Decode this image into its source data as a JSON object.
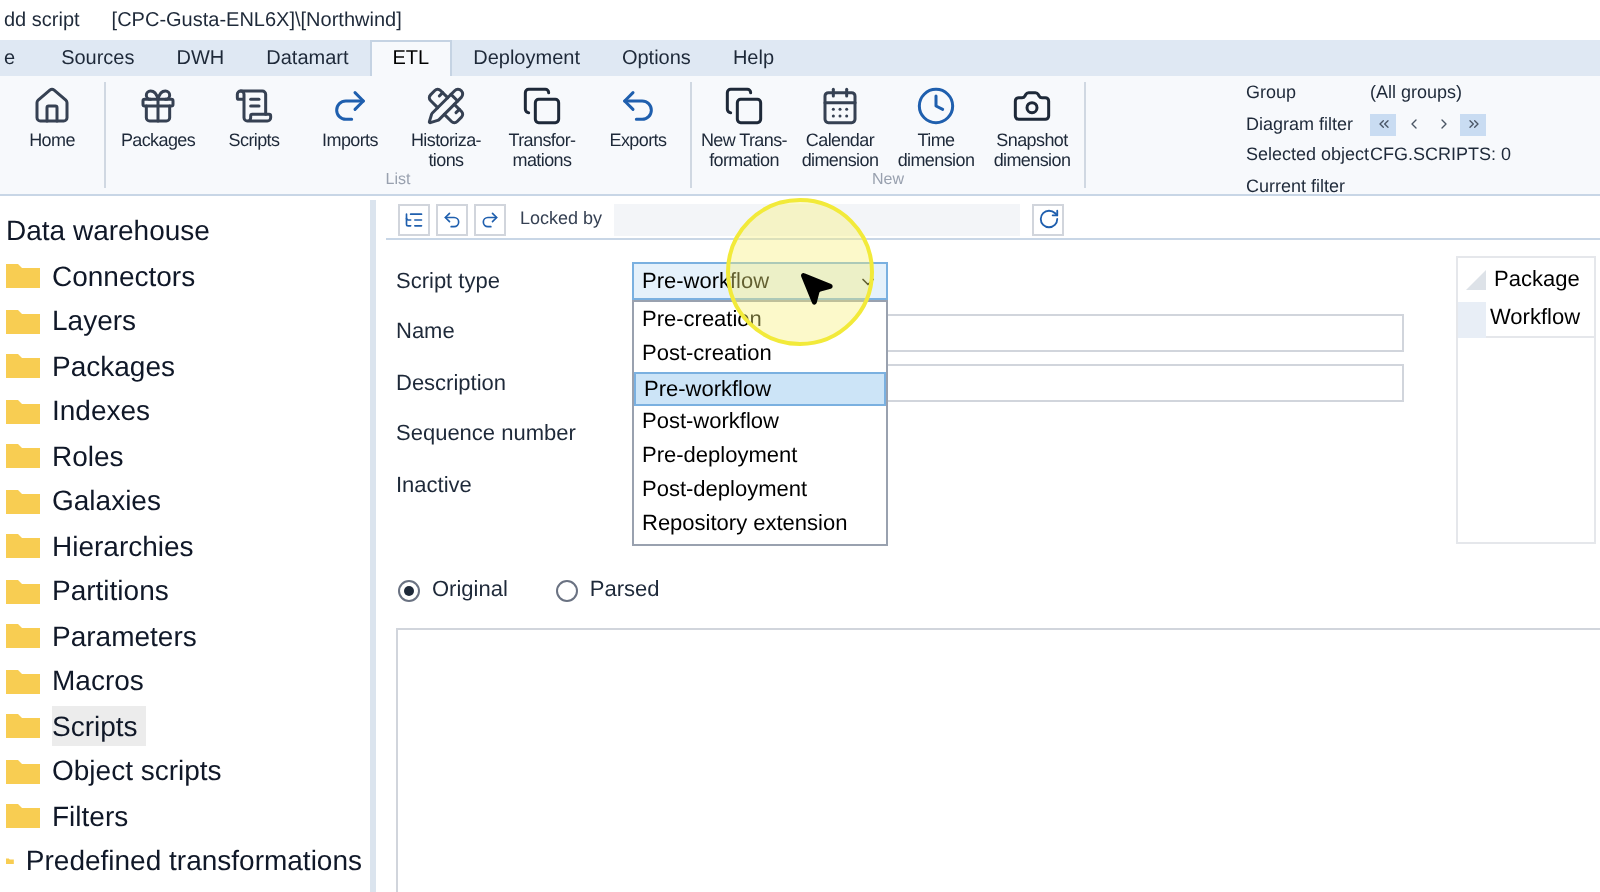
{
  "window": {
    "title": "dd script",
    "path": "[CPC-Gusta-ENL6X]\\[Northwind]"
  },
  "tabs": [
    {
      "label": "e",
      "selected": false
    },
    {
      "label": "Sources",
      "selected": false
    },
    {
      "label": "DWH",
      "selected": false
    },
    {
      "label": "Datamart",
      "selected": false
    },
    {
      "label": "ETL",
      "selected": true
    },
    {
      "label": "Deployment",
      "selected": false
    },
    {
      "label": "Options",
      "selected": false
    },
    {
      "label": "Help",
      "selected": false
    }
  ],
  "ribbon": {
    "groups": [
      {
        "buttons": [
          {
            "label": "Home",
            "kind": "home"
          }
        ]
      },
      {
        "label": "List",
        "buttons": [
          {
            "label": "Packages",
            "kind": "gift"
          },
          {
            "label": "Scripts",
            "kind": "scroll"
          },
          {
            "label": "Imports",
            "kind": "redo"
          },
          {
            "label": "Historiza-\ntions",
            "kind": "historize"
          },
          {
            "label": "Transfor-\nmations",
            "kind": "copy"
          },
          {
            "label": "Exports",
            "kind": "undo"
          }
        ]
      },
      {
        "label": "New",
        "buttons": [
          {
            "label": "New Trans-\nformation",
            "kind": "copy"
          },
          {
            "label": "Calendar\ndimension",
            "kind": "calendar"
          },
          {
            "label": "Time\ndimension",
            "kind": "clock"
          },
          {
            "label": "Snapshot\ndimension",
            "kind": "camera"
          }
        ]
      }
    ],
    "info": [
      {
        "label": "Group",
        "value": "(All groups)"
      },
      {
        "label": "Diagram filter",
        "kind": "nav"
      },
      {
        "label": "Selected object",
        "value": "CFG.SCRIPTS: 0"
      },
      {
        "label": "Current filter"
      }
    ]
  },
  "tree": {
    "label": "Data warehouse",
    "children": [
      {
        "label": "Connectors",
        "selected": false
      },
      {
        "label": "Layers",
        "selected": false
      },
      {
        "label": "Packages",
        "selected": false
      },
      {
        "label": "Indexes",
        "selected": false
      },
      {
        "label": "Roles",
        "selected": false
      },
      {
        "label": "Galaxies",
        "selected": false
      },
      {
        "label": "Hierarchies",
        "selected": false
      },
      {
        "label": "Partitions",
        "selected": false
      },
      {
        "label": "Parameters",
        "selected": false
      },
      {
        "label": "Macros",
        "selected": false
      },
      {
        "label": "Scripts",
        "selected": true
      },
      {
        "label": "Object scripts",
        "selected": false
      },
      {
        "label": "Filters",
        "selected": false
      },
      {
        "label": "Predefined transformations",
        "selected": false
      }
    ]
  },
  "toolbar": {
    "locked_by_label": "Locked by"
  },
  "form": {
    "fields": [
      {
        "label": "Script type",
        "kind": "dropdown",
        "value": "Pre-workflow",
        "expanded": true,
        "options": [
          {
            "label": "Pre-creation",
            "selected": false
          },
          {
            "label": "Post-creation",
            "selected": false
          },
          {
            "label": "Pre-workflow",
            "selected": true
          },
          {
            "label": "Post-workflow",
            "selected": false
          },
          {
            "label": "Pre-deployment",
            "selected": false
          },
          {
            "label": "Post-deployment",
            "selected": false
          },
          {
            "label": "Repository extension",
            "selected": false
          }
        ]
      },
      {
        "label": "Name",
        "kind": "text"
      },
      {
        "label": "Description",
        "kind": "text"
      },
      {
        "label": "Sequence number",
        "kind": "none"
      },
      {
        "label": "Inactive",
        "kind": "none"
      }
    ]
  },
  "packages_grid": {
    "column": "Package",
    "rows": [
      "Workflow"
    ]
  },
  "view_mode": [
    {
      "label": "Original",
      "selected": true
    },
    {
      "label": "Parsed",
      "selected": false
    }
  ]
}
